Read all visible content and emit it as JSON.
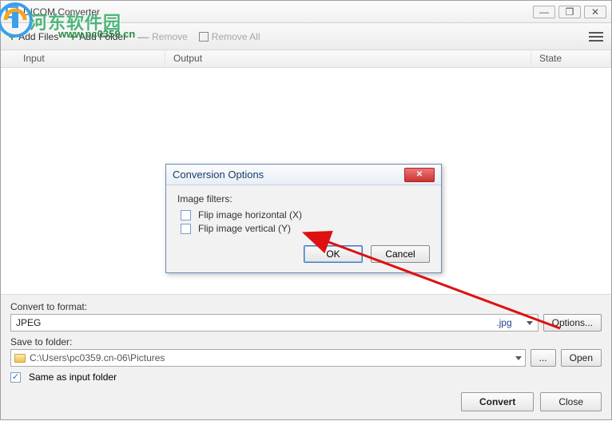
{
  "window": {
    "title": "DICOM Converter",
    "min_label": "—",
    "max_label": "❐",
    "close_label": "✕"
  },
  "toolbar": {
    "add_files": "Add Files",
    "add_folder": "Add Folder",
    "remove": "Remove",
    "remove_all": "Remove All"
  },
  "table": {
    "input": "Input",
    "output": "Output",
    "state": "State"
  },
  "dialog": {
    "title": "Conversion Options",
    "filters_label": "Image filters:",
    "flip_h": "Flip image horizontal (X)",
    "flip_v": "Flip image vertical (Y)",
    "ok": "OK",
    "cancel": "Cancel"
  },
  "bottom": {
    "convert_label": "Convert to format:",
    "format_value": "JPEG",
    "format_ext": ".jpg",
    "options_btn": "Options...",
    "save_label": "Save to folder:",
    "folder_path": "C:\\Users\\pc0359.cn-06\\Pictures",
    "browse_btn": "...",
    "open_btn": "Open",
    "same_folder": "Same as input folder",
    "convert_btn": "Convert",
    "close_btn": "Close"
  },
  "watermark": {
    "text": "河东软件园",
    "url": "www.pc0359.cn"
  }
}
